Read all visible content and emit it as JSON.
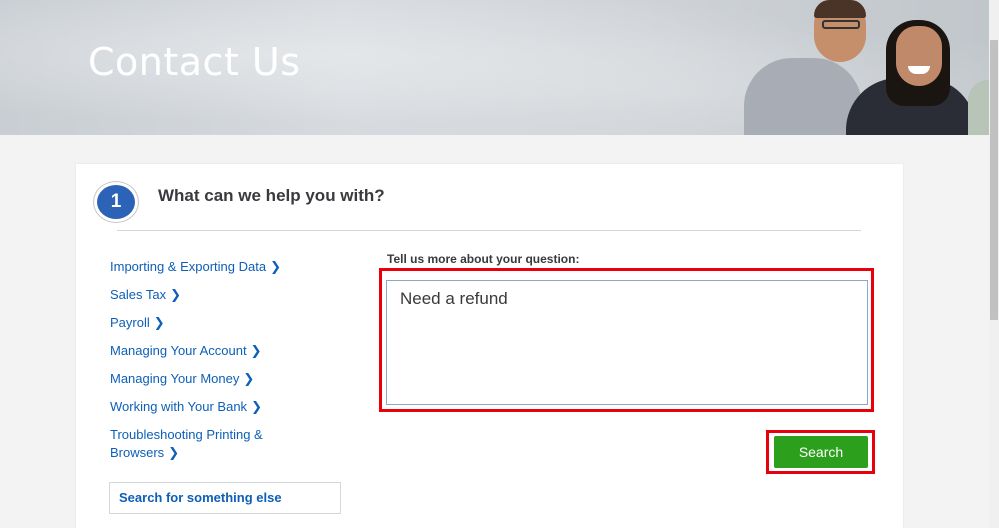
{
  "hero": {
    "title": "Contact Us"
  },
  "step": {
    "number": "1",
    "title": "What can we help you with?"
  },
  "topics": [
    {
      "label": "Importing & Exporting Data"
    },
    {
      "label": "Sales Tax"
    },
    {
      "label": "Payroll"
    },
    {
      "label": "Managing Your Account"
    },
    {
      "label": "Managing Your Money"
    },
    {
      "label": "Working with Your Bank"
    },
    {
      "label": "Troubleshooting Printing & Browsers"
    }
  ],
  "chevron": "❯",
  "search_else": {
    "label": "Search for something else"
  },
  "question": {
    "label": "Tell us more about your question:",
    "value": "Need a refund"
  },
  "search_button": {
    "label": "Search"
  },
  "colors": {
    "accent_blue": "#2d63b6",
    "link": "#0d5fb7",
    "button_green": "#2ca01c",
    "highlight_red": "#e8000b"
  }
}
